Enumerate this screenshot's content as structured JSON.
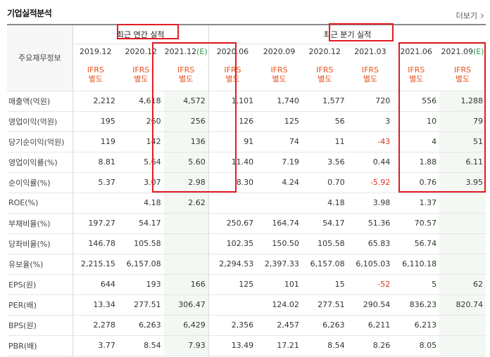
{
  "header": {
    "title": "기업실적분석",
    "more_label": "더보기"
  },
  "table": {
    "corner_label": "주요재무정보",
    "groups": [
      "최근 연간 실적",
      "최근 분기 실적"
    ],
    "periods": [
      {
        "label": "2019.12",
        "e": "",
        "type": [
          "IFRS",
          "별도"
        ]
      },
      {
        "label": "2020.12",
        "e": "",
        "type": [
          "IFRS",
          "별도"
        ]
      },
      {
        "label": "2021.12",
        "e": "(E)",
        "type": [
          "IFRS",
          "별도"
        ]
      },
      {
        "label": "2020.06",
        "e": "",
        "type": [
          "IFRS",
          "별도"
        ]
      },
      {
        "label": "2020.09",
        "e": "",
        "type": [
          "IFRS",
          "별도"
        ]
      },
      {
        "label": "2020.12",
        "e": "",
        "type": [
          "IFRS",
          "별도"
        ]
      },
      {
        "label": "2021.03",
        "e": "",
        "type": [
          "IFRS",
          "별도"
        ]
      },
      {
        "label": "2021.06",
        "e": "",
        "type": [
          "IFRS",
          "별도"
        ]
      },
      {
        "label": "2021.09",
        "e": "(E)",
        "type": [
          "IFRS",
          "별도"
        ]
      }
    ],
    "rows": [
      {
        "label": "매출액(억원)",
        "values": [
          "2,212",
          "4,618",
          "4,572",
          "1,101",
          "1,740",
          "1,577",
          "720",
          "556",
          "1,288"
        ]
      },
      {
        "label": "영업이익(억원)",
        "values": [
          "195",
          "260",
          "256",
          "126",
          "125",
          "56",
          "3",
          "10",
          "79"
        ]
      },
      {
        "label": "당기순이익(억원)",
        "values": [
          "119",
          "142",
          "136",
          "91",
          "74",
          "11",
          "-43",
          "4",
          "51"
        ]
      },
      {
        "label": "영업이익률(%)",
        "values": [
          "8.81",
          "5.64",
          "5.60",
          "11.40",
          "7.19",
          "3.56",
          "0.44",
          "1.88",
          "6.11"
        ]
      },
      {
        "label": "순이익률(%)",
        "values": [
          "5.37",
          "3.07",
          "2.98",
          "8.30",
          "4.24",
          "0.70",
          "-5.92",
          "0.76",
          "3.95"
        ]
      },
      {
        "label": "ROE(%)",
        "values": [
          "",
          "4.18",
          "2.62",
          "",
          "",
          "4.18",
          "3.98",
          "1.37",
          ""
        ]
      },
      {
        "label": "부채비율(%)",
        "values": [
          "197.27",
          "54.17",
          "",
          "250.67",
          "164.74",
          "54.17",
          "51.36",
          "70.57",
          ""
        ]
      },
      {
        "label": "당좌비율(%)",
        "values": [
          "146.78",
          "105.58",
          "",
          "102.35",
          "150.50",
          "105.58",
          "65.83",
          "56.74",
          ""
        ]
      },
      {
        "label": "유보율(%)",
        "values": [
          "2,215.15",
          "6,157.08",
          "",
          "2,294.53",
          "2,397.33",
          "6,157.08",
          "6,105.03",
          "6,110.18",
          ""
        ]
      },
      {
        "label": "EPS(원)",
        "values": [
          "644",
          "193",
          "166",
          "125",
          "101",
          "15",
          "-52",
          "5",
          "62"
        ]
      },
      {
        "label": "PER(배)",
        "values": [
          "13.34",
          "277.51",
          "306.47",
          "",
          "124.02",
          "277.51",
          "290.54",
          "836.23",
          "820.74"
        ]
      },
      {
        "label": "BPS(원)",
        "values": [
          "2,278",
          "6,263",
          "6,429",
          "2,356",
          "2,457",
          "6,263",
          "6,211",
          "6,213",
          ""
        ]
      },
      {
        "label": "PBR(배)",
        "values": [
          "3.77",
          "8.54",
          "7.93",
          "13.49",
          "17.21",
          "8.54",
          "8.26",
          "8.05",
          ""
        ]
      }
    ]
  },
  "colors": {
    "ifrs": "#e8531f",
    "estimate": "#2a9a4a",
    "negative": "#e0301e",
    "highlight_box": "#e31b23"
  }
}
